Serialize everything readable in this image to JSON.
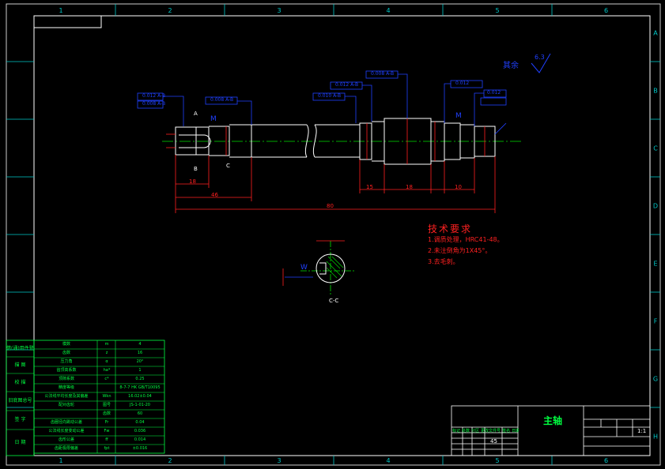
{
  "frame": {
    "columns": [
      "1",
      "2",
      "3",
      "4",
      "5",
      "6"
    ],
    "rows": [
      "A",
      "B",
      "C",
      "D",
      "E",
      "F",
      "G",
      "H"
    ]
  },
  "drawing": {
    "surface_finish": "其余",
    "surface_value": "6.3",
    "dims": {
      "total_length": "80",
      "left_len": "18",
      "seg_len": "46",
      "right_a": "15",
      "right_b": "18",
      "right_c": "10"
    },
    "tolerances": {
      "t1": "0.012 A-B",
      "t2": "0.008 A-B",
      "t3": "0.008 A-B",
      "t4": "0.010 A-B",
      "t5": "0.012 A-B",
      "t6": "0.008 A-B",
      "t7": "0.012",
      "t8": "0.012"
    },
    "datum_labels": [
      "A",
      "B",
      "C",
      "M",
      "M"
    ],
    "section_label": "C-C",
    "section_keyway": "W",
    "tech_req": {
      "title": "技术要求",
      "items": [
        "1.调质处理，HRC41-48。",
        "2.未注倒角为1X45°。",
        "3.去毛刺。"
      ]
    }
  },
  "left_stamp": [
    "借(通)用件登记",
    "描  图",
    "校  描",
    "旧底图总号",
    "签  字",
    "日  期"
  ],
  "gear_table": [
    [
      "模数",
      "m",
      "4"
    ],
    [
      "齿数",
      "z",
      "16"
    ],
    [
      "压力角",
      "α",
      "20°"
    ],
    [
      "齿顶高系数",
      "ha*",
      "1"
    ],
    [
      "顶隙系数",
      "c*",
      "0.25"
    ],
    [
      "精度等级",
      "",
      "8-7-7 HK GB/T10095"
    ],
    [
      "公法线平均长度及其偏差",
      "Wkn",
      "16.02±0.04"
    ],
    [
      "配对齿轮",
      "图号",
      "JS-1-01-20"
    ],
    [
      "",
      "齿数",
      "60"
    ],
    [
      "齿圈径向跳动公差",
      "Fr",
      "0.04"
    ],
    [
      "公法线长度变动公差",
      "Fw",
      "0.036"
    ],
    [
      "齿形公差",
      "ff",
      "0.014"
    ],
    [
      "齿距极限偏差",
      "fpt",
      "±0.016"
    ]
  ],
  "title_block": {
    "part_name": "主轴",
    "scale": "1:1",
    "material": "45",
    "header": [
      "标记",
      "处数",
      "分区",
      "更改文件号",
      "签名",
      "日期"
    ]
  }
}
